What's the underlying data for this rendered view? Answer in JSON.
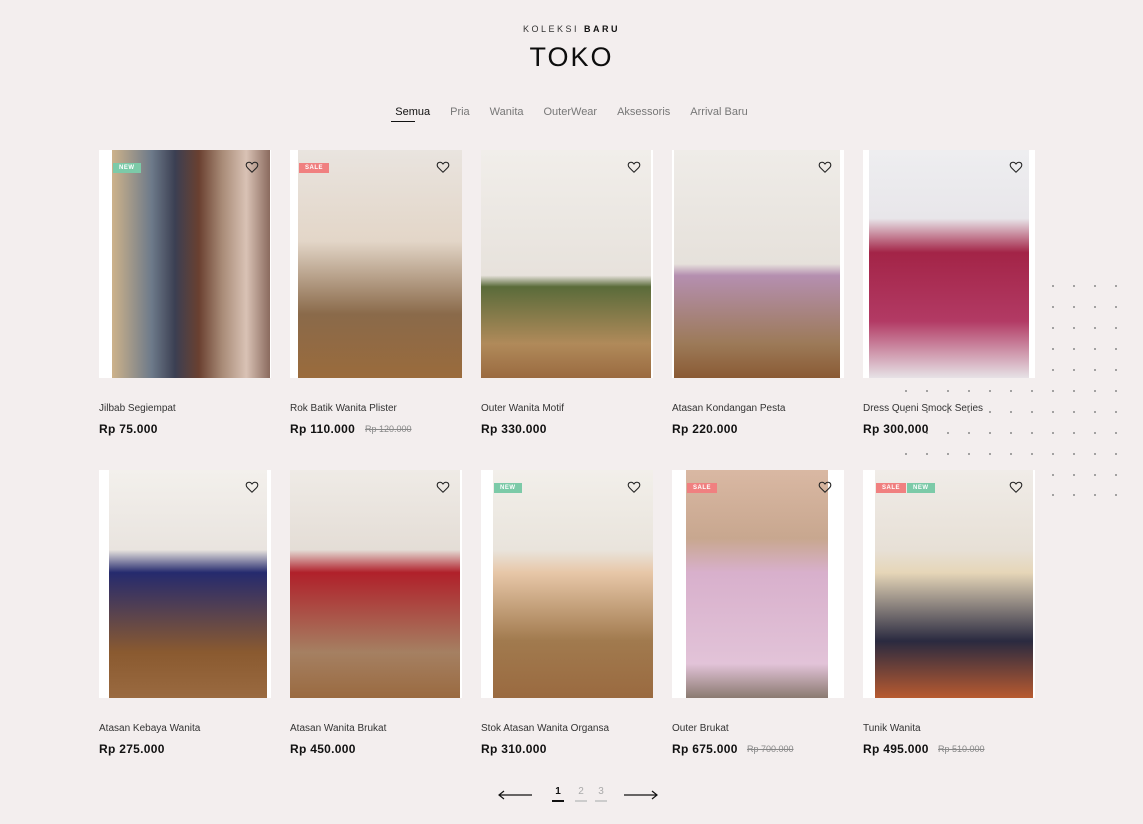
{
  "header": {
    "eyebrow_light": "KOLEKSI",
    "eyebrow_bold": "BARU",
    "title": "TOKO"
  },
  "tabs": [
    {
      "label": "Semua",
      "active": true
    },
    {
      "label": "Pria",
      "active": false
    },
    {
      "label": "Wanita",
      "active": false
    },
    {
      "label": "OuterWear",
      "active": false
    },
    {
      "label": "Aksessoris",
      "active": false
    },
    {
      "label": "Arrival Baru",
      "active": false
    }
  ],
  "products": [
    {
      "name": "Jilbab Segiempat",
      "price": "Rp 75.000",
      "old_price": "",
      "badges": [
        "NEW"
      ]
    },
    {
      "name": "Rok Batik Wanita Plister",
      "price": "Rp 110.000",
      "old_price": "Rp 120.000",
      "badges": [
        "SALE"
      ]
    },
    {
      "name": "Outer Wanita Motif",
      "price": "Rp 330.000",
      "old_price": "",
      "badges": []
    },
    {
      "name": "Atasan Kondangan Pesta",
      "price": "Rp 220.000",
      "old_price": "",
      "badges": []
    },
    {
      "name": "Dress Queni Smock Series",
      "price": "Rp 300.000",
      "old_price": "",
      "badges": []
    },
    {
      "name": "Atasan Kebaya Wanita",
      "price": "Rp 275.000",
      "old_price": "",
      "badges": []
    },
    {
      "name": "Atasan Wanita Brukat",
      "price": "Rp 450.000",
      "old_price": "",
      "badges": []
    },
    {
      "name": "Stok Atasan Wanita Organsa",
      "price": "Rp 310.000",
      "old_price": "",
      "badges": [
        "NEW"
      ]
    },
    {
      "name": "Outer Brukat",
      "price": "Rp 675.000",
      "old_price": "Rp 700.000",
      "badges": [
        "SALE"
      ]
    },
    {
      "name": "Tunik Wanita",
      "price": "Rp 495.000",
      "old_price": "Rp 510.000",
      "badges": [
        "SALE",
        "NEW"
      ]
    }
  ],
  "pagination": {
    "pages": [
      "1",
      "2",
      "3"
    ],
    "current": "1",
    "prev_icon": "arrow-left-icon",
    "next_icon": "arrow-right-icon"
  },
  "icons": {
    "wishlist": "heart-icon"
  },
  "colors": {
    "background": "#f3eeee",
    "badge_new": "#7ccaa8",
    "badge_sale": "#f08080"
  }
}
